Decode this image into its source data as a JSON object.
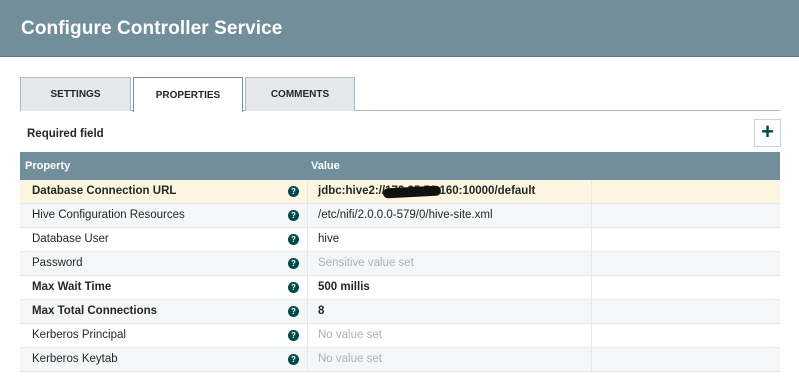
{
  "dialog": {
    "title": "Configure Controller Service"
  },
  "tabs": [
    {
      "label": "SETTINGS",
      "active": false
    },
    {
      "label": "PROPERTIES",
      "active": true
    },
    {
      "label": "COMMENTS",
      "active": false
    }
  ],
  "required_label": "Required field",
  "add_icon": "plus-icon",
  "help_icon": "question-icon",
  "grid": {
    "columns": {
      "property": "Property",
      "value": "Value"
    },
    "rows": [
      {
        "name": "Database Connection URL",
        "value": "jdbc:hive2://172.25.50.160:10000/default",
        "required": true,
        "placeholder": false,
        "selected": true
      },
      {
        "name": "Hive Configuration Resources",
        "value": "/etc/nifi/2.0.0.0-579/0/hive-site.xml",
        "required": false,
        "placeholder": false,
        "selected": false
      },
      {
        "name": "Database User",
        "value": "hive",
        "required": false,
        "placeholder": false,
        "selected": false
      },
      {
        "name": "Password",
        "value": "Sensitive value set",
        "required": false,
        "placeholder": true,
        "selected": false
      },
      {
        "name": "Max Wait Time",
        "value": "500 millis",
        "required": true,
        "placeholder": false,
        "selected": false
      },
      {
        "name": "Max Total Connections",
        "value": "8",
        "required": true,
        "placeholder": false,
        "selected": false
      },
      {
        "name": "Kerberos Principal",
        "value": "No value set",
        "required": false,
        "placeholder": true,
        "selected": false
      },
      {
        "name": "Kerberos Keytab",
        "value": "No value set",
        "required": false,
        "placeholder": true,
        "selected": false
      }
    ]
  },
  "colors": {
    "header_bg": "#728e9b",
    "accent": "#004849",
    "selected_row": "#fcf6e0",
    "placeholder_text": "#a8b3b8"
  }
}
